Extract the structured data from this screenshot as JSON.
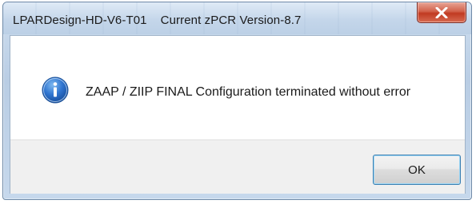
{
  "window": {
    "title": "LPARDesign-HD-V6-T01    Current zPCR Version-8.7"
  },
  "dialog": {
    "icon": "info-icon",
    "message": "ZAAP / ZIIP FINAL Configuration terminated without error",
    "ok_label": "OK"
  },
  "colors": {
    "close_button": "#c13a22",
    "info_icon": "#1e63c4",
    "button_focus_border": "#3c7fb1"
  }
}
